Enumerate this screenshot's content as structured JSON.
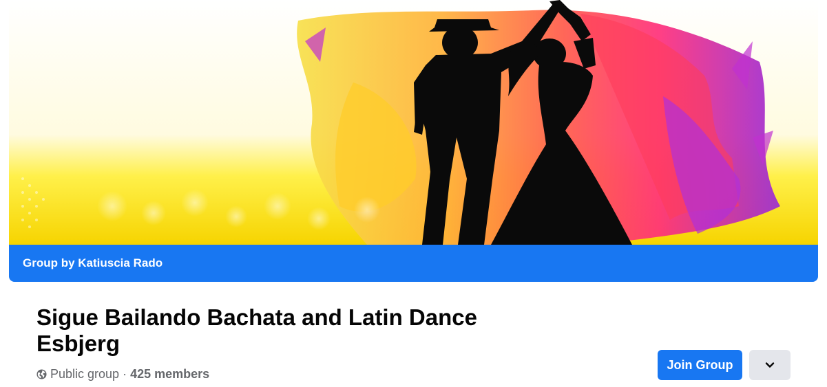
{
  "cover": {
    "image": "dance-couple-silhouette-cover",
    "banner_text": "Group by Katiuscia Rado"
  },
  "group": {
    "name": "Sigue Bailando Bachata and Latin Dance Esbjerg",
    "privacy": "Public group",
    "separator": "·",
    "members": "425 members"
  },
  "actions": {
    "join_label": "Join Group",
    "more_icon": "chevron-down-icon"
  },
  "colors": {
    "brand_blue": "#1877f2",
    "secondary_button": "#e4e6eb",
    "text_primary": "#050505",
    "text_secondary": "#65676b"
  }
}
